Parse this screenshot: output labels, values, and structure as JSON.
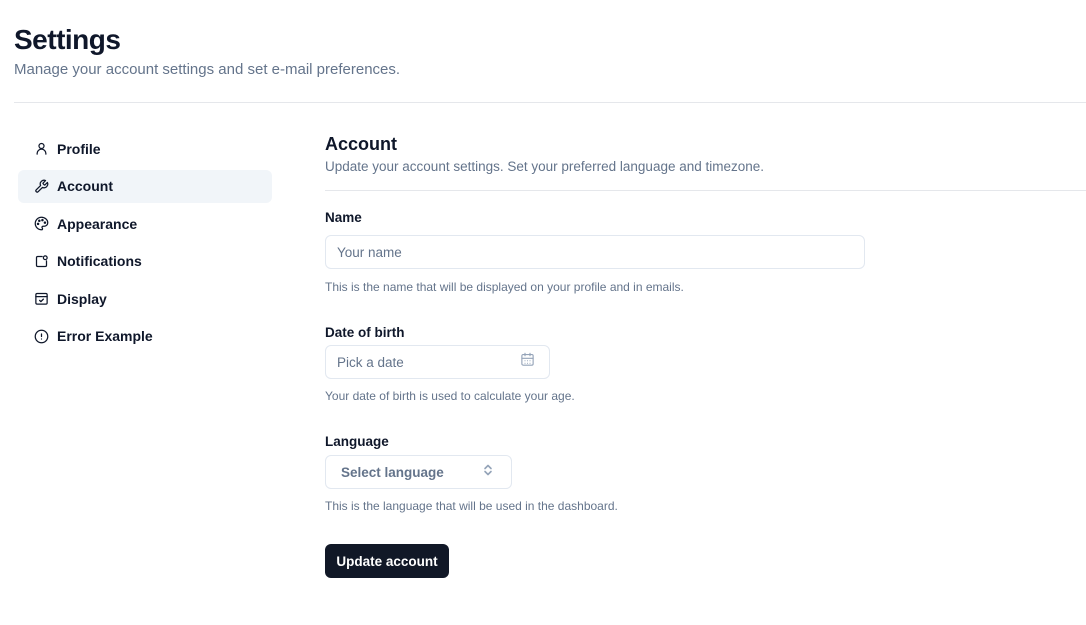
{
  "header": {
    "title": "Settings",
    "subtitle": "Manage your account settings and set e-mail preferences."
  },
  "sidebar": {
    "items": [
      {
        "label": "Profile",
        "icon": "user-icon",
        "active": false
      },
      {
        "label": "Account",
        "icon": "wrench-icon",
        "active": true
      },
      {
        "label": "Appearance",
        "icon": "palette-icon",
        "active": false
      },
      {
        "label": "Notifications",
        "icon": "bell-square-icon",
        "active": false
      },
      {
        "label": "Display",
        "icon": "calendar-check-icon",
        "active": false
      },
      {
        "label": "Error Example",
        "icon": "alert-circle-icon",
        "active": false
      }
    ]
  },
  "main": {
    "title": "Account",
    "description": "Update your account settings. Set your preferred language and timezone.",
    "name_field": {
      "label": "Name",
      "placeholder": "Your name",
      "value": "",
      "description": "This is the name that will be displayed on your profile and in emails."
    },
    "dob_field": {
      "label": "Date of birth",
      "placeholder": "Pick a date",
      "icon": "calendar-icon",
      "description": "Your date of birth is used to calculate your age."
    },
    "language_field": {
      "label": "Language",
      "placeholder": "Select language",
      "icon": "chevrons-up-down-icon",
      "description": "This is the language that will be used in the dashboard."
    },
    "submit_label": "Update account"
  },
  "colors": {
    "primary": "#111827",
    "muted_text": "#64748b",
    "border": "#e2e8f0",
    "active_bg": "#f1f5f9"
  }
}
